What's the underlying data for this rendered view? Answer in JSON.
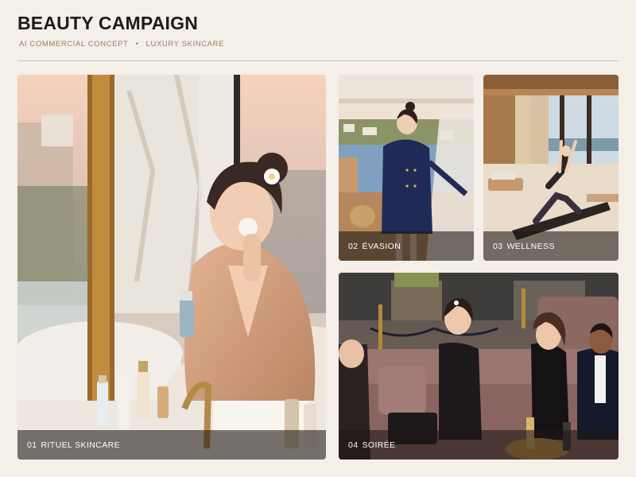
{
  "header": {
    "title": "BEAUTY CAMPAIGN",
    "subtitle_part1": "AI Commercial Concept",
    "subtitle_separator": "•",
    "subtitle_part2": "Luxury Skincare"
  },
  "tiles": [
    {
      "number": "01",
      "label": "RITUEL SKINCARE",
      "image": "woman-applying-skincare-at-marble-vanity"
    },
    {
      "number": "02",
      "label": "ÉVASION",
      "image": "woman-in-navy-blazer-dress-on-yacht-deck"
    },
    {
      "number": "03",
      "label": "WELLNESS",
      "image": "woman-doing-yoga-on-yacht-lounge"
    },
    {
      "number": "04",
      "label": "SOIRÉE",
      "image": "friends-laughing-on-velvet-sofa-at-rooftop-party"
    }
  ],
  "colors": {
    "background": "#f4efe9",
    "title": "#1c1c1c",
    "subtitle": "#a07c60",
    "caption_overlay": "rgba(30,24,20,0.58)"
  }
}
